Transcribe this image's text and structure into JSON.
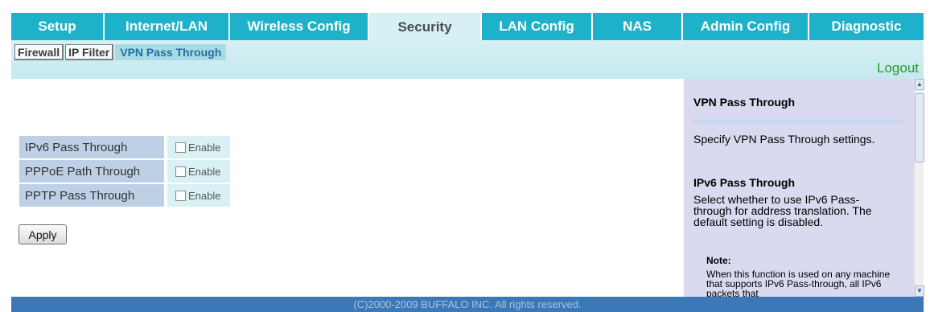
{
  "nav": {
    "tabs": [
      {
        "label": "Setup"
      },
      {
        "label": "Internet/LAN"
      },
      {
        "label": "Wireless Config"
      },
      {
        "label": "Security"
      },
      {
        "label": "LAN Config"
      },
      {
        "label": "NAS"
      },
      {
        "label": "Admin Config"
      },
      {
        "label": "Diagnostic"
      }
    ],
    "active": "Security"
  },
  "subnav": {
    "tabs": [
      {
        "label": "Firewall"
      },
      {
        "label": "IP Filter"
      },
      {
        "label": "VPN Pass Through"
      }
    ],
    "active": "VPN Pass Through"
  },
  "header": {
    "logout": "Logout"
  },
  "form": {
    "rows": [
      {
        "label": "IPv6 Pass Through",
        "option": "Enable",
        "checked": false
      },
      {
        "label": "PPPoE Path Through",
        "option": "Enable",
        "checked": false
      },
      {
        "label": "PPTP Pass Through",
        "option": "Enable",
        "checked": false
      }
    ],
    "apply_label": "Apply"
  },
  "help": {
    "title": "VPN Pass Through",
    "intro": "Specify VPN Pass Through settings.",
    "section_title": "IPv6 Pass Through",
    "section_text": "Select whether to use IPv6 Pass-through for address translation. The default setting is disabled.",
    "note_title": "Note:",
    "note_text": "When this function is used on any machine that supports IPv6 Pass-through, all IPv6 packets that"
  },
  "footer": {
    "copyright": "(C)2000-2009 BUFFALO INC. All rights reserved."
  },
  "colors": {
    "nav_bg": "#1db2c9",
    "nav_active_bg": "#d6f0f4",
    "band_bg": "#d6f0f4",
    "help_bg": "#d9daf0",
    "footer_bg": "#3b78b8",
    "logout": "#2a9a2a"
  }
}
